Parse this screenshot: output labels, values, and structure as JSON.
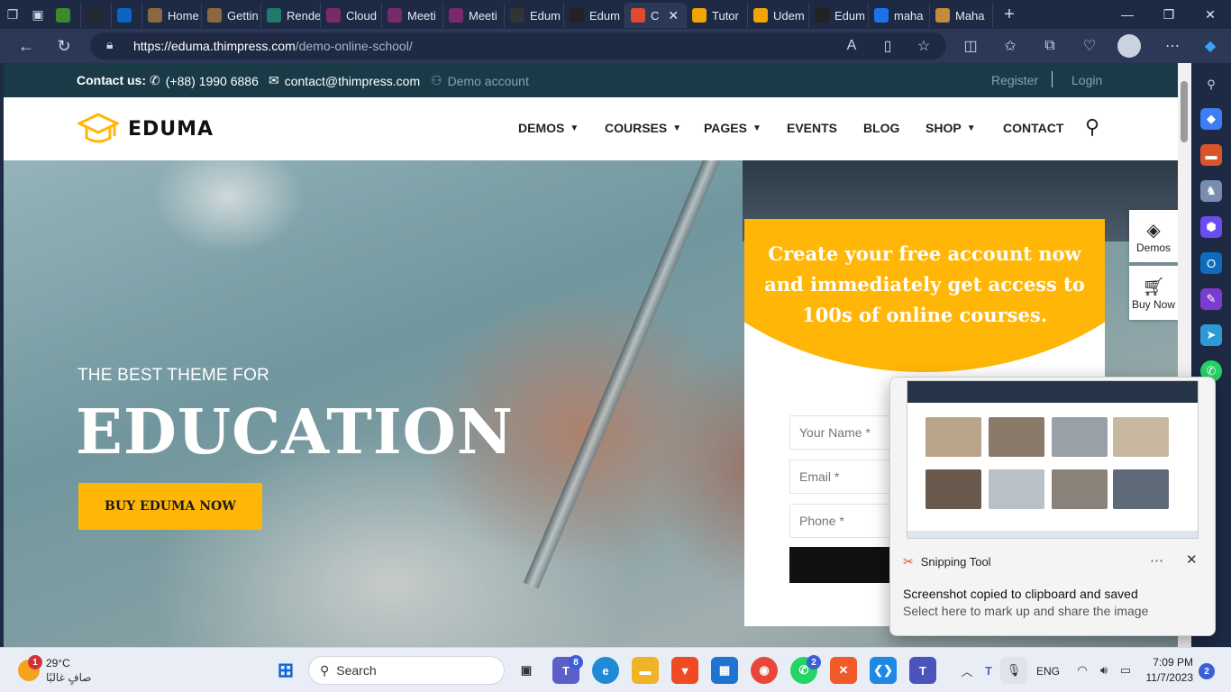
{
  "browser": {
    "tabs": [
      {
        "label": "",
        "fav": "#3c8a2e"
      },
      {
        "label": "",
        "fav": "#24292f"
      },
      {
        "label": "",
        "fav": "#0a66c2"
      },
      {
        "label": "Home",
        "fav": "#8a6a3c"
      },
      {
        "label": "Gettin",
        "fav": "#8a6a3c"
      },
      {
        "label": "Rende",
        "fav": "#1f7a6b"
      },
      {
        "label": "Cloud",
        "fav": "#7a2a6a"
      },
      {
        "label": "Meeti",
        "fav": "#7a2a6a"
      },
      {
        "label": "Meeti",
        "fav": "#7a2a6a"
      },
      {
        "label": "Edum",
        "fav": "#333333"
      },
      {
        "label": "Edum",
        "fav": "#222222"
      },
      {
        "label": "C",
        "fav": "#e04a2f"
      },
      {
        "label": "Tutor",
        "fav": "#f0a500"
      },
      {
        "label": "Udem",
        "fav": "#f0a500"
      },
      {
        "label": "Edum",
        "fav": "#222222"
      },
      {
        "label": "maha",
        "fav": "#1a73e8"
      },
      {
        "label": "Maha",
        "fav": "#c58a3a"
      }
    ],
    "active_tab_index": 11,
    "url_host": "https://eduma.thimpress.com",
    "url_path": "/demo-online-school/"
  },
  "site": {
    "contact_label": "Contact us:",
    "phone": "(+88) 1990 6886",
    "email": "contact@thimpress.com",
    "demo_account": "Demo account",
    "register": "Register",
    "login": "Login",
    "logo_text": "EDUMA",
    "nav": {
      "demos": "DEMOS",
      "courses": "COURSES",
      "pages": "PAGES",
      "events": "EVENTS",
      "blog": "BLOG",
      "shop": "SHOP",
      "contact": "CONTACT"
    },
    "hero": {
      "subtitle": "THE BEST THEME FOR",
      "title": "EDUCATION",
      "cta": "BUY EDUMA NOW"
    },
    "signup": {
      "heading": "Create your free account now and immediately get access to 100s of online courses.",
      "name_placeholder": "Your Name *",
      "email_placeholder": "Email *",
      "phone_placeholder": "Phone *"
    },
    "float_demos": "Demos",
    "float_buy": "Buy Now",
    "accent": "#ffb606"
  },
  "notification": {
    "app": "Snipping Tool",
    "line1": "Screenshot copied to clipboard and saved",
    "line2": "Select here to mark up and share the image"
  },
  "taskbar": {
    "weather_temp": "29°C",
    "weather_desc": "صافٍ غالبًا",
    "weather_badge": "1",
    "search_label": "Search",
    "teams_badge": "8",
    "whatsapp_badge": "2",
    "lang": "ENG",
    "time": "7:09 PM",
    "date": "11/7/2023",
    "notif_count": "2"
  }
}
